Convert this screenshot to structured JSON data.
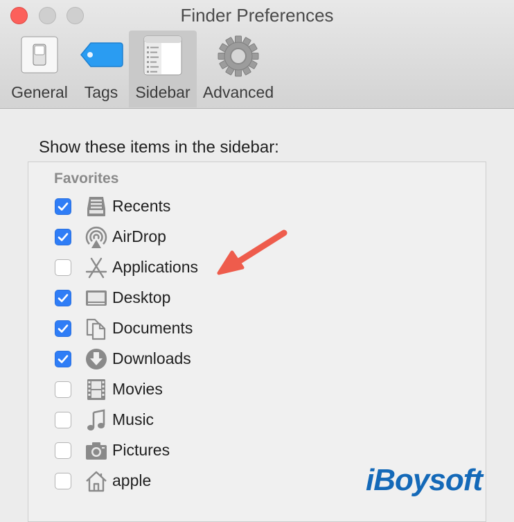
{
  "window": {
    "title": "Finder Preferences"
  },
  "tabs": [
    {
      "label": "General",
      "icon": "switch-icon",
      "selected": false
    },
    {
      "label": "Tags",
      "icon": "tag-icon",
      "selected": false
    },
    {
      "label": "Sidebar",
      "icon": "sidebar-icon",
      "selected": true
    },
    {
      "label": "Advanced",
      "icon": "gear-icon",
      "selected": false
    }
  ],
  "content": {
    "heading": "Show these items in the sidebar:",
    "section": "Favorites",
    "items": [
      {
        "label": "Recents",
        "icon": "recents-icon",
        "checked": true
      },
      {
        "label": "AirDrop",
        "icon": "airdrop-icon",
        "checked": true
      },
      {
        "label": "Applications",
        "icon": "applications-icon",
        "checked": false
      },
      {
        "label": "Desktop",
        "icon": "desktop-icon",
        "checked": true
      },
      {
        "label": "Documents",
        "icon": "documents-icon",
        "checked": true
      },
      {
        "label": "Downloads",
        "icon": "downloads-icon",
        "checked": true
      },
      {
        "label": "Movies",
        "icon": "movies-icon",
        "checked": false
      },
      {
        "label": "Music",
        "icon": "music-icon",
        "checked": false
      },
      {
        "label": "Pictures",
        "icon": "pictures-icon",
        "checked": false
      },
      {
        "label": "apple",
        "icon": "home-icon",
        "checked": false
      }
    ]
  },
  "watermark": "iBoysoft",
  "colors": {
    "accent": "#2f7df6",
    "close": "#fc605b",
    "arrow": "#ee5c4c",
    "watermark": "#1469b8"
  }
}
